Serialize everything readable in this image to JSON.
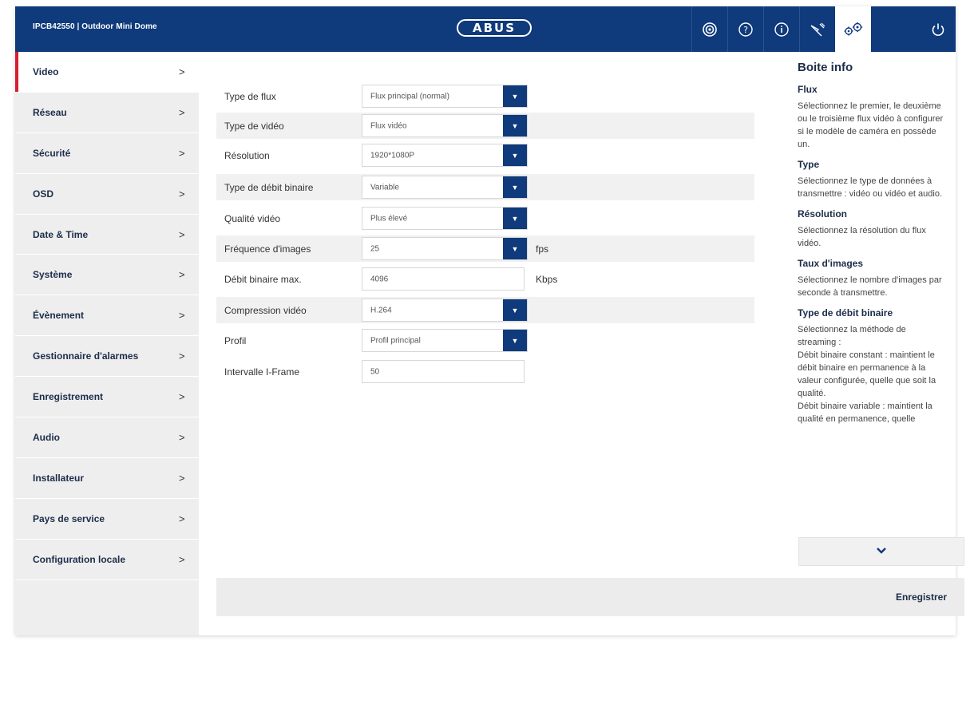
{
  "header": {
    "device_title": "IPCB42550 | Outdoor Mini Dome",
    "logo_text": "ABUS",
    "icons": [
      "live-view-icon",
      "help-icon",
      "info-icon",
      "playback-icon",
      "settings-icon",
      "power-icon"
    ]
  },
  "sidebar": {
    "items": [
      {
        "label": "Video",
        "chevron": ">"
      },
      {
        "label": "Réseau",
        "chevron": ">"
      },
      {
        "label": "Sécurité",
        "chevron": ">"
      },
      {
        "label": "OSD",
        "chevron": ">"
      },
      {
        "label": "Date & Time",
        "chevron": ">"
      },
      {
        "label": "Système",
        "chevron": ">"
      },
      {
        "label": "Évènement",
        "chevron": ">"
      },
      {
        "label": "Gestionnaire d'alarmes",
        "chevron": ">"
      },
      {
        "label": "Enregistrement",
        "chevron": ">"
      },
      {
        "label": "Audio",
        "chevron": ">"
      },
      {
        "label": "Installateur",
        "chevron": ">"
      },
      {
        "label": "Pays de service",
        "chevron": ">"
      },
      {
        "label": "Configuration locale",
        "chevron": ">"
      }
    ]
  },
  "form": {
    "stream_type": {
      "label": "Type de flux",
      "value": "Flux principal (normal)"
    },
    "video_type": {
      "label": "Type de vidéo",
      "value": "Flux vidéo"
    },
    "resolution": {
      "label": "Résolution",
      "value": "1920*1080P"
    },
    "bitrate_type": {
      "label": "Type de débit binaire",
      "value": "Variable"
    },
    "video_quality": {
      "label": "Qualité vidéo",
      "value": "Plus élevé"
    },
    "frame_rate": {
      "label": "Fréquence d'images",
      "value": "25",
      "unit": "fps"
    },
    "max_bitrate": {
      "label": "Débit binaire max.",
      "value": "4096",
      "unit": "Kbps"
    },
    "compression": {
      "label": "Compression vidéo",
      "value": "H.264"
    },
    "profile": {
      "label": "Profil",
      "value": "Profil principal"
    },
    "iframe_interval": {
      "label": "Intervalle I-Frame",
      "value": "50"
    }
  },
  "info": {
    "title": "Boite info",
    "sections": [
      {
        "heading": "Flux",
        "text": "Sélectionnez le premier, le deuxième ou le troisième flux vidéo à configurer si le modèle de caméra en possède un."
      },
      {
        "heading": "Type",
        "text": "Sélectionnez le type de données à transmettre : vidéo ou vidéo et audio."
      },
      {
        "heading": "Résolution",
        "text": "Sélectionnez la résolution du flux vidéo."
      },
      {
        "heading": "Taux d'images",
        "text": "Sélectionnez le nombre d'images par seconde à transmettre."
      },
      {
        "heading": "Type de débit binaire",
        "text": "Sélectionnez la méthode de streaming :"
      }
    ],
    "constant_text": "Débit binaire constant : maintient le débit binaire en permanence à la valeur configurée, quelle que soit la qualité.",
    "variable_text": "Débit binaire variable : maintient la qualité en permanence, quelle"
  },
  "footer": {
    "save_label": "Enregistrer"
  }
}
